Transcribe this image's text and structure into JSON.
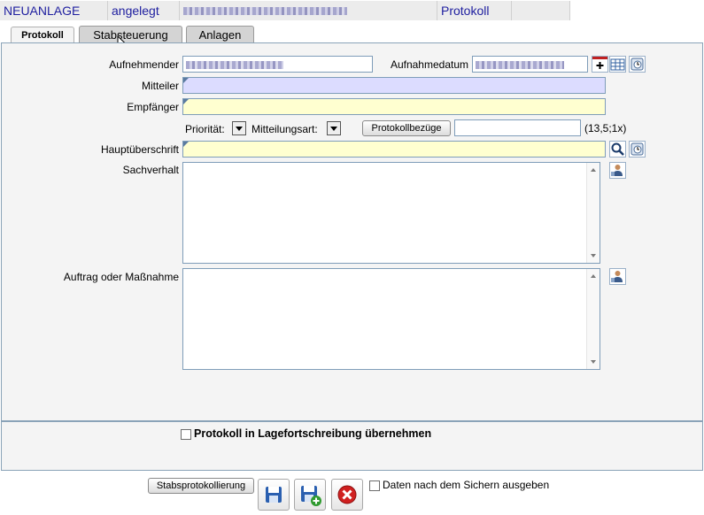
{
  "status": {
    "mode": "NEUANLAGE",
    "state": "angelegt",
    "section": "Protokoll"
  },
  "tabs": [
    {
      "label": "Protokoll",
      "active": true
    },
    {
      "label": "Stabsteuerung",
      "active": false
    },
    {
      "label": "Anlagen",
      "active": false
    }
  ],
  "form": {
    "aufnehmender_label": "Aufnehmender",
    "aufnahmedatum_label": "Aufnahmedatum",
    "mitteiler_label": "Mitteiler",
    "empfaenger_label": "Empfänger",
    "prioritaet_label": "Priorität:",
    "mitteilungsart_label": "Mitteilungsart:",
    "protokollbezuege_button": "Protokollbezüge",
    "count_hint": "(13,5;1x)",
    "hauptueberschrift_label": "Hauptüberschrift",
    "sachverhalt_label": "Sachverhalt",
    "auftrag_label": "Auftrag oder Maßnahme",
    "lagefortschreibung_label": "Protokoll in Lagefortschreibung übernehmen"
  },
  "footer": {
    "stabsprotokollierung_button": "Stabsprotokollierung",
    "daten_label": "Daten nach dem Sichern ausgeben"
  },
  "icons": [
    "calendar-add-icon",
    "calendar-grid-icon",
    "clock-icon",
    "search-icon",
    "person-icon",
    "save-icon",
    "save-new-icon",
    "cancel-icon"
  ],
  "colors": {
    "status_text": "#2020a0",
    "field_violet": "#dcdcff",
    "field_yellow": "#ffffd0",
    "cancel_red": "#d02020"
  }
}
